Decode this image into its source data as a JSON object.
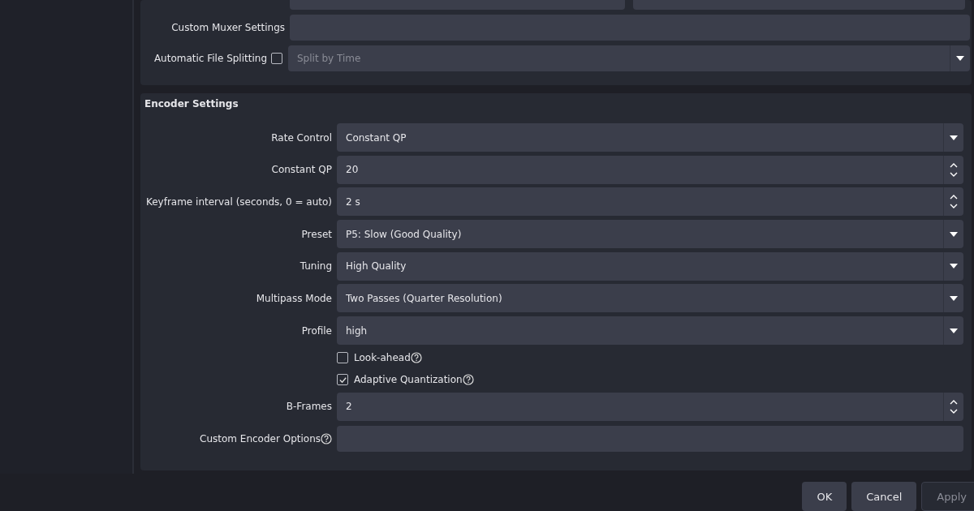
{
  "output_group": {
    "rescale_row": {
      "kind": "cut"
    },
    "muxer": {
      "label": "Custom Muxer Settings"
    },
    "file_splitting": {
      "label": "Automatic File Splitting",
      "checked": false,
      "value": "Split by Time",
      "disabled": true
    }
  },
  "encoder": {
    "title": "Encoder Settings",
    "rows": [
      {
        "kind": "dropdown",
        "label": "Rate Control",
        "value": "Constant QP"
      },
      {
        "kind": "spin",
        "label": "Constant QP",
        "value": "20"
      },
      {
        "kind": "spin",
        "label": "Keyframe interval (seconds, 0 = auto)",
        "value": "2 s"
      },
      {
        "kind": "dropdown",
        "label": "Preset",
        "value": "P5: Slow (Good Quality)"
      },
      {
        "kind": "dropdown",
        "label": "Tuning",
        "value": "High Quality"
      },
      {
        "kind": "dropdown",
        "label": "Multipass Mode",
        "value": "Two Passes (Quarter Resolution)"
      },
      {
        "kind": "dropdown",
        "label": "Profile",
        "value": "high"
      },
      {
        "kind": "checkbox",
        "label": "Look-ahead",
        "checked": false,
        "help": true
      },
      {
        "kind": "checkbox",
        "label": "Adaptive Quantization",
        "checked": true,
        "help": true
      },
      {
        "kind": "spin",
        "label": "B-Frames",
        "value": "2"
      },
      {
        "kind": "text",
        "label": "Custom Encoder Options",
        "help": true
      }
    ]
  },
  "buttons": [
    {
      "label": "OK",
      "disabled": false
    },
    {
      "label": "Cancel",
      "disabled": false
    },
    {
      "label": "Apply",
      "disabled": true
    }
  ]
}
